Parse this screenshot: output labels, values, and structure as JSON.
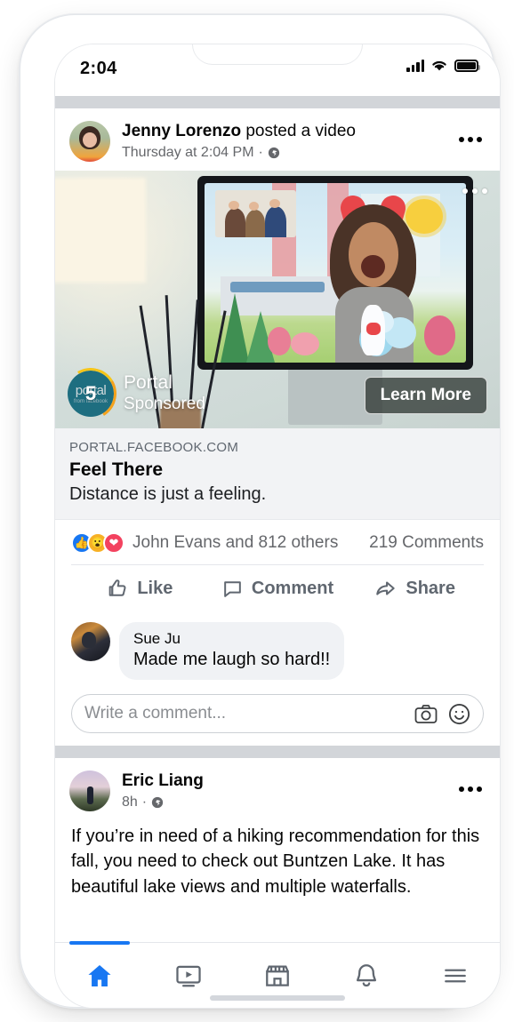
{
  "status_bar": {
    "time": "2:04",
    "signal_icon": "cellular-signal-icon",
    "wifi_icon": "wifi-icon",
    "battery_icon": "battery-icon"
  },
  "posts": [
    {
      "author": "Jenny Lorenzo",
      "action": " posted a video",
      "timestamp": "Thursday at 2:04 PM",
      "privacy_icon": "globe-icon",
      "menu_icon": "more-options-icon",
      "video": {
        "countdown": "5",
        "brand_title": "Portal",
        "brand_subtitle": "Sponsored",
        "brand_logo_text": "portal",
        "brand_logo_subtext": "from facebook",
        "cta_label": "Learn More",
        "overlay_menu_icon": "video-more-options-icon"
      },
      "link_preview": {
        "url": "PORTAL.FACEBOOK.COM",
        "title": "Feel There",
        "description": "Distance is just a feeling."
      },
      "reactions": {
        "icons": [
          "like-reaction",
          "wow-reaction",
          "love-reaction"
        ],
        "summary": "John Evans and 812 others",
        "comments": "219 Comments"
      },
      "actions": [
        {
          "label": "Like",
          "icon": "thumbs-up-icon"
        },
        {
          "label": "Comment",
          "icon": "comment-bubble-icon"
        },
        {
          "label": "Share",
          "icon": "share-arrow-icon"
        }
      ],
      "comment": {
        "author": "Sue Ju",
        "text": "Made me laugh so hard!!"
      },
      "composer": {
        "placeholder": "Write a comment...",
        "camera_icon": "camera-icon",
        "sticker_icon": "emoji-smiley-icon"
      }
    },
    {
      "author": "Eric Liang",
      "timestamp": "8h",
      "privacy_icon": "globe-icon",
      "menu_icon": "more-options-icon",
      "text": "If you’re in need of a hiking recommendation for this fall, you need to check out Buntzen Lake. It has beautiful lake views and multiple waterfalls."
    }
  ],
  "bottom_nav": {
    "active": "home",
    "active_color": "#1877f2",
    "items": [
      {
        "name": "home",
        "icon": "home-icon"
      },
      {
        "name": "watch",
        "icon": "watch-video-icon"
      },
      {
        "name": "marketplace",
        "icon": "marketplace-store-icon"
      },
      {
        "name": "notifications",
        "icon": "bell-icon"
      },
      {
        "name": "menu",
        "icon": "hamburger-menu-icon"
      }
    ]
  }
}
